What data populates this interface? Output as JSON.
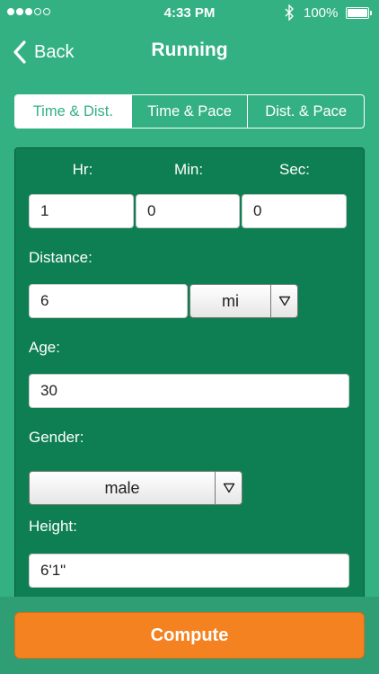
{
  "status_bar": {
    "time": "4:33 PM",
    "battery_percent": "100%",
    "battery_level": 1.0,
    "signal_bars_filled": 3,
    "signal_bars_total": 5
  },
  "nav": {
    "back_label": "Back",
    "title": "Running"
  },
  "tabs": [
    {
      "label": "Time & Dist.",
      "active": true
    },
    {
      "label": "Time & Pace",
      "active": false
    },
    {
      "label": "Dist. & Pace",
      "active": false
    }
  ],
  "form": {
    "hr_label": "Hr:",
    "min_label": "Min:",
    "sec_label": "Sec:",
    "hr_value": "1",
    "min_value": "0",
    "sec_value": "0",
    "distance_label": "Distance:",
    "distance_value": "6",
    "distance_unit": "mi",
    "age_label": "Age:",
    "age_value": "30",
    "gender_label": "Gender:",
    "gender_value": "male",
    "height_label": "Height:",
    "height_value": "6'1\""
  },
  "compute_label": "Compute",
  "colors": {
    "background": "#33b183",
    "card": "#0e7f53",
    "accent_button": "#f58220"
  }
}
